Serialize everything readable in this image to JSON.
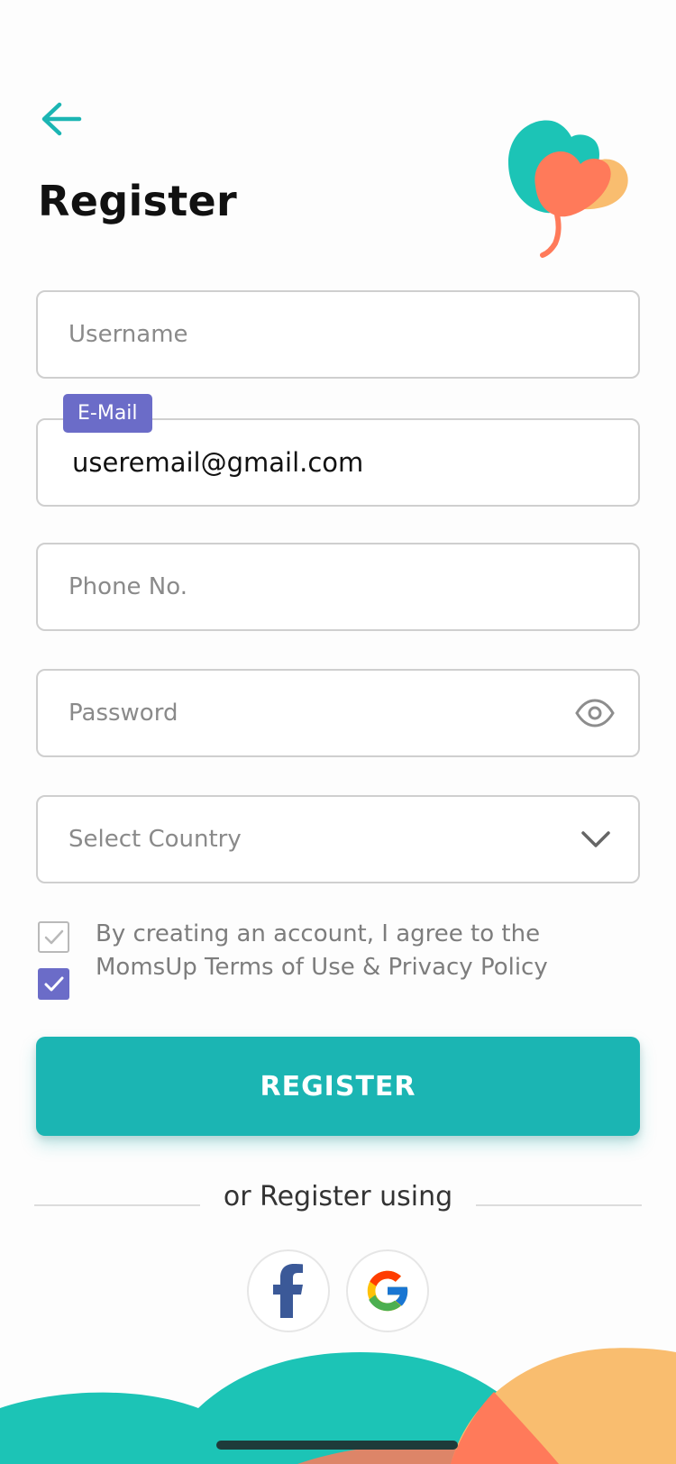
{
  "header": {
    "title": "Register",
    "back_icon": "arrow-left-icon",
    "accent_color": "#1bb5b3"
  },
  "form": {
    "username": {
      "placeholder": "Username",
      "value": ""
    },
    "email": {
      "label": "E-Mail",
      "value": "useremail@gmail.com"
    },
    "phone": {
      "placeholder": "Phone No.",
      "value": ""
    },
    "password": {
      "placeholder": "Password",
      "value": "",
      "toggle_icon": "eye-icon"
    },
    "country": {
      "placeholder": "Select Country",
      "value": "",
      "dropdown_icon": "chevron-down-icon"
    }
  },
  "terms": {
    "text": "By creating an account, I agree to the MomsUp Terms of Use & Privacy Policy",
    "checked": true
  },
  "register_button": {
    "label": "REGISTER"
  },
  "social": {
    "divider_text": "or Register using",
    "providers": [
      {
        "name": "Facebook",
        "icon": "facebook-icon"
      },
      {
        "name": "Google",
        "icon": "google-icon"
      }
    ]
  },
  "colors": {
    "primary": "#1bb5b3",
    "label_purple": "#6b6cc8",
    "teal_shape": "#1cc4b6",
    "coral_shape": "#ff7a5a",
    "peach_shape": "#f9bd6f"
  }
}
